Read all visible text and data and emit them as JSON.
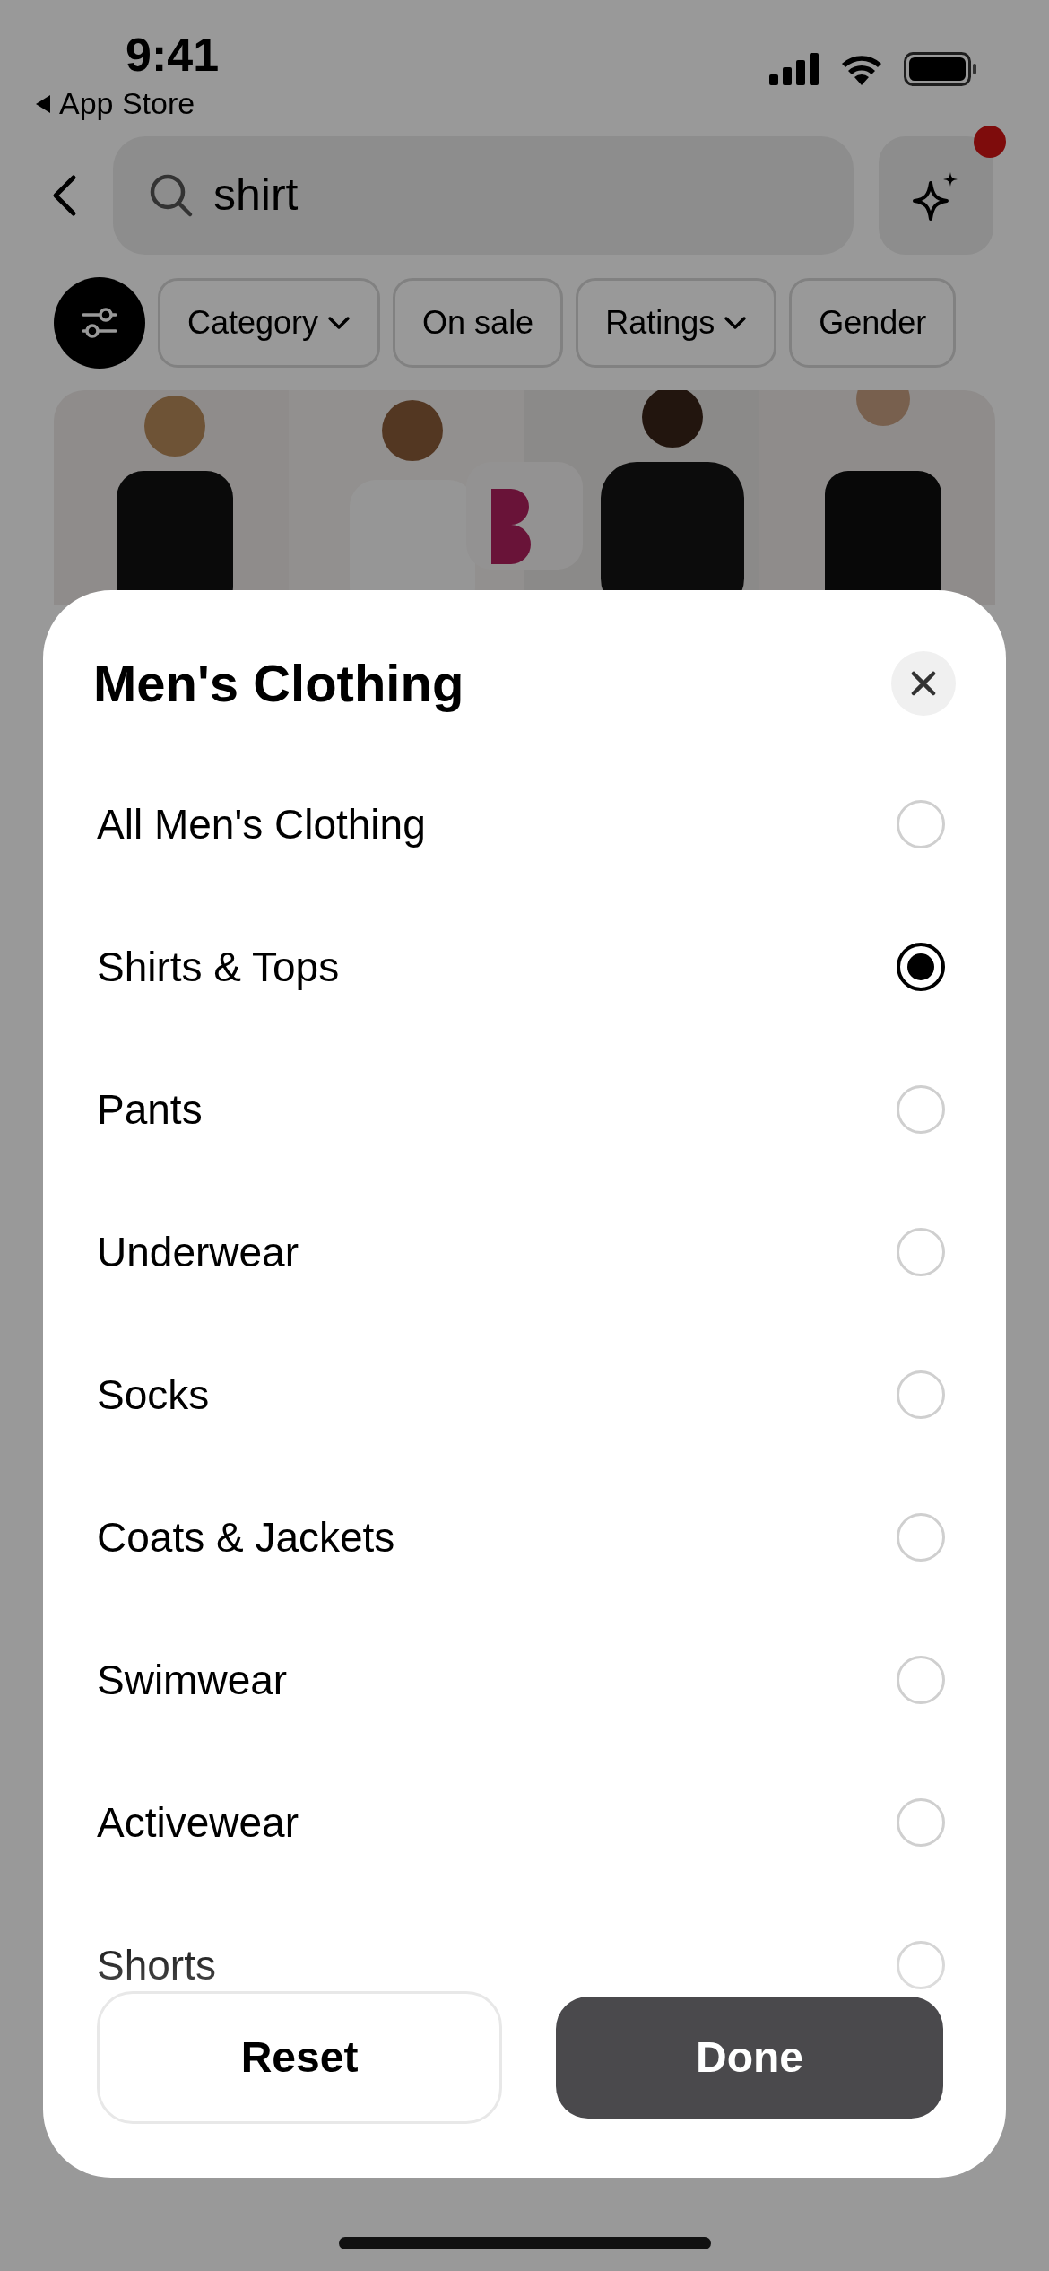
{
  "status_bar": {
    "time": "9:41",
    "back_link": "App Store"
  },
  "search": {
    "value": "shirt"
  },
  "assistant": {
    "notification": true
  },
  "filters": [
    {
      "label": "Category",
      "dropdown": true
    },
    {
      "label": "On sale",
      "dropdown": false
    },
    {
      "label": "Ratings",
      "dropdown": true
    },
    {
      "label": "Gender",
      "dropdown": false
    }
  ],
  "sheet": {
    "title": "Men's Clothing",
    "options": [
      {
        "label": "All Men's Clothing",
        "selected": false
      },
      {
        "label": "Shirts & Tops",
        "selected": true
      },
      {
        "label": "Pants",
        "selected": false
      },
      {
        "label": "Underwear",
        "selected": false
      },
      {
        "label": "Socks",
        "selected": false
      },
      {
        "label": "Coats & Jackets",
        "selected": false
      },
      {
        "label": "Swimwear",
        "selected": false
      },
      {
        "label": "Activewear",
        "selected": false
      },
      {
        "label": "Shorts",
        "selected": false
      }
    ],
    "buttons": {
      "reset": "Reset",
      "done": "Done"
    }
  }
}
